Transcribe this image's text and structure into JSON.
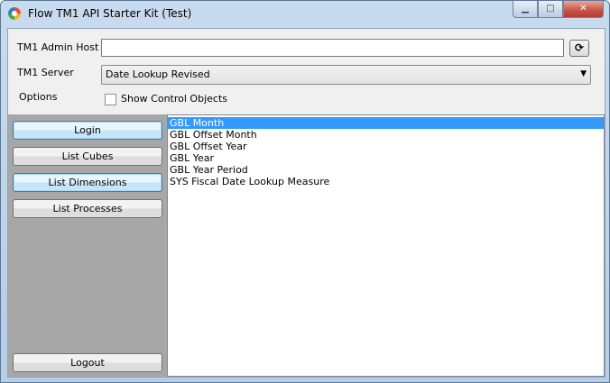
{
  "window": {
    "title": "Flow TM1 API Starter Kit (Test)",
    "controls": {
      "minimize": "▁",
      "maximize": "□",
      "close": "✕"
    }
  },
  "form": {
    "admin_host_label": "TM1 Admin Host",
    "admin_host_value": "",
    "refresh_icon": "refresh-icon",
    "refresh_glyph": "⟳",
    "server_label": "TM1 Server",
    "server_value": "Date Lookup Revised",
    "dropdown_glyph": "▼",
    "options_label": "Options",
    "show_control_objects_label": "Show Control Objects",
    "show_control_objects_checked": false
  },
  "buttons": {
    "login": "Login",
    "list_cubes": "List Cubes",
    "list_dimensions": "List Dimensions",
    "list_processes": "List Processes",
    "logout": "Logout"
  },
  "list": {
    "items": [
      "GBL Month",
      "GBL Offset Month",
      "GBL Offset Year",
      "GBL Year",
      "GBL Year Period",
      "SYS Fiscal Date Lookup Measure"
    ],
    "selected_index": 0
  },
  "colors": {
    "selection": "#3399ff",
    "left_panel": "#a7a7a7",
    "close_button": "#c75145"
  }
}
